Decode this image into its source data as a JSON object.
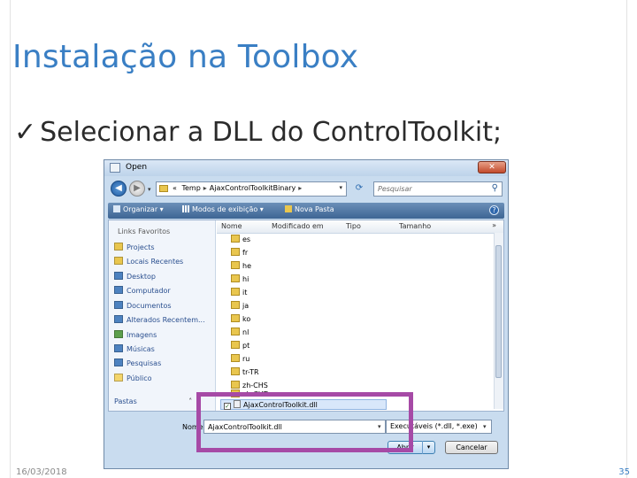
{
  "slide": {
    "title": "Instalação na Toolbox",
    "bullet_mark": "✓",
    "bullet": "Selecionar a DLL do ControlToolkit;",
    "date": "16/03/2018",
    "page_number": "35"
  },
  "dialog": {
    "title": "Open",
    "close_glyph": "✕",
    "back_glyph": "◀",
    "forward_glyph": "▶",
    "address": {
      "prefix": "«",
      "segments": [
        "Temp",
        "AjaxControlToolkitBinary"
      ],
      "separator": "▸"
    },
    "search": {
      "placeholder": "Pesquisar"
    },
    "toolbar": {
      "organize": "Organizar ▾",
      "views": "Modos de exibição ▾",
      "new_folder": "Nova Pasta",
      "help": "?"
    },
    "favorites": {
      "header": "Links Favoritos",
      "items": [
        {
          "label": "Projects",
          "icon": "folder-icon"
        },
        {
          "label": "Locais Recentes",
          "icon": "folder-icon"
        },
        {
          "label": "Desktop",
          "icon": "desktop-icon"
        },
        {
          "label": "Computador",
          "icon": "computer-icon"
        },
        {
          "label": "Documentos",
          "icon": "documents-icon"
        },
        {
          "label": "Alterados Recentem...",
          "icon": "recent-icon"
        },
        {
          "label": "Imagens",
          "icon": "images-icon"
        },
        {
          "label": "Músicas",
          "icon": "music-icon"
        },
        {
          "label": "Pesquisas",
          "icon": "search-folder-icon"
        },
        {
          "label": "Público",
          "icon": "folder-icon"
        }
      ],
      "folders_label": "Pastas"
    },
    "columns": [
      "Nome",
      "Modificado em",
      "Tipo",
      "Tamanho"
    ],
    "more_columns": "»",
    "files": [
      "es",
      "fr",
      "he",
      "hi",
      "it",
      "ja",
      "ko",
      "nl",
      "pt",
      "ru",
      "tr-TR",
      "zh-CHS",
      "zh-CHT"
    ],
    "selected_file": "AjaxControlToolkit.dll",
    "filename": {
      "label": "Nome:",
      "value": "AjaxControlToolkit.dll"
    },
    "filetype": "Executáveis (*.dll, *.exe)",
    "open_button": "Abrir",
    "cancel_button": "Cancelar"
  },
  "colors": {
    "title_blue": "#3a7fc4",
    "highlight_purple": "#a64aa6",
    "dialog_frame": "#c9dcef"
  }
}
